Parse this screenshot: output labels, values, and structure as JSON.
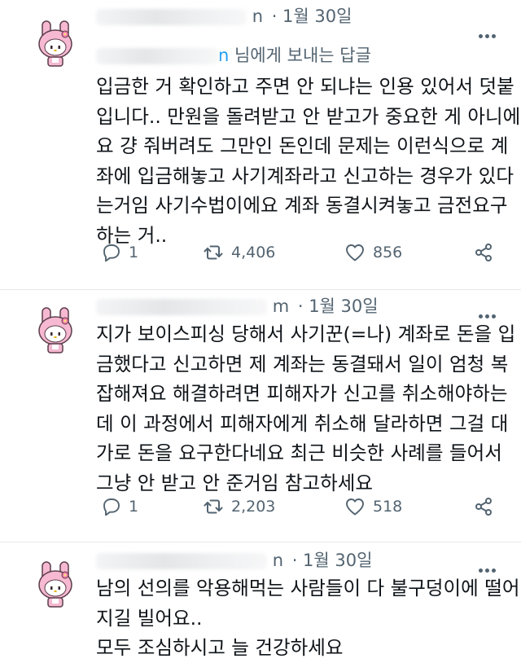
{
  "colors": {
    "accent": "#1d9bf0",
    "text": "#0f1419",
    "muted": "#536471",
    "divider": "#e6e9eb"
  },
  "tweets": [
    {
      "handle_tail": "n",
      "date": "· 1월 30일",
      "reply_to_user": "n",
      "reply_to_suffix": " 님에게 보내는 답글",
      "lines": [
        "입금한 거 확인하고 주면 안 되냐는 인용 있어서 덧붙",
        "입니다.. 만원을 돌려받고 안 받고가 중요한 게 아니에",
        "요 걍 줘버려도 그만인 돈인데 문제는 이런식으로 계",
        "좌에 입금해놓고 사기계좌라고 신고하는 경우가 있다",
        "는거임 사기수법이에요 계좌 동결시켜놓고 금전요구",
        "하는 거.."
      ],
      "replies": "1",
      "retweets": "4,406",
      "likes": "856"
    },
    {
      "handle_tail": "m",
      "date": "· 1월 30일",
      "lines": [
        "지가 보이스피싱 당해서 사기꾼(=나) 계좌로 돈을 입",
        "금했다고 신고하면 제 계좌는 동결돼서 일이 엄청 복",
        "잡해져요 해결하려면 피해자가 신고를 취소해야하는",
        "데 이 과정에서 피해자에게 취소해 달라하면 그걸 대",
        "가로 돈을 요구한다네요 최근 비슷한 사례를 들어서",
        "그냥 안 받고 안 준거임 참고하세요"
      ],
      "replies": "1",
      "retweets": "2,203",
      "likes": "518"
    },
    {
      "handle_tail": "n",
      "date": "· 1월 30일",
      "lines": [
        "남의 선의를 악용해먹는 사람들이 다 불구덩이에 떨어",
        "지길 빌어요..",
        "모두 조심하시고 늘 건강하세요"
      ]
    }
  ],
  "icons": {
    "avatar": "my-melody-avatar",
    "reply": "speech-bubble-icon",
    "retweet": "retweet-icon",
    "like": "heart-icon",
    "share": "share-icon",
    "more": "more-dots-icon"
  }
}
